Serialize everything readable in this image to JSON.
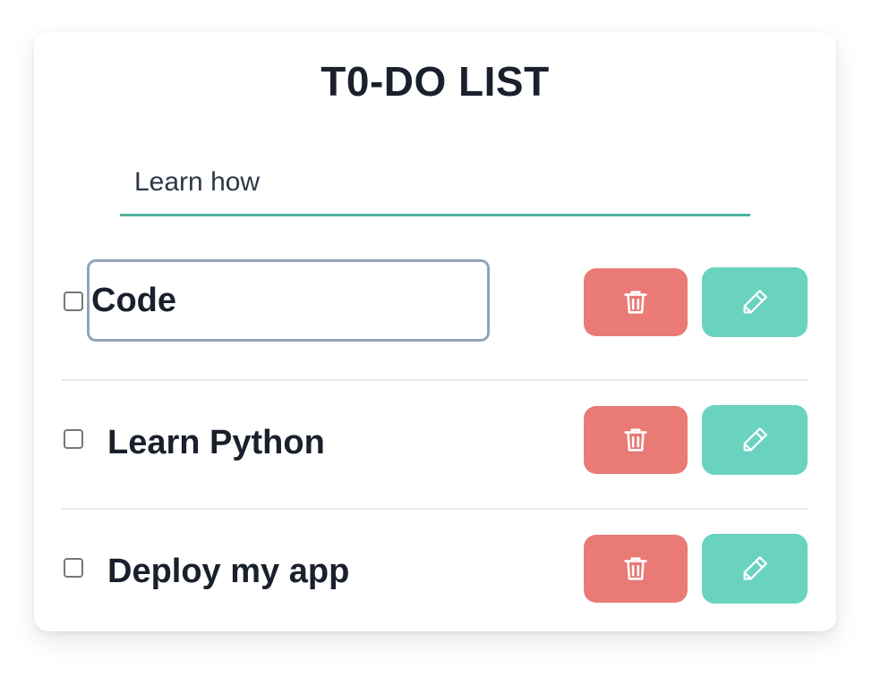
{
  "app": {
    "title": "T0-DO LIST"
  },
  "new_todo": {
    "value": "Learn how"
  },
  "todos": [
    {
      "label": "Code",
      "editing": true,
      "checked": false
    },
    {
      "label": "Learn Python",
      "editing": false,
      "checked": false
    },
    {
      "label": "Deploy my app",
      "editing": false,
      "checked": false
    }
  ],
  "icons": {
    "delete": "trash-icon",
    "edit": "pencil-icon"
  },
  "colors": {
    "delete": "#e97a75",
    "edit": "#69d3c0",
    "accent": "#4fb3a0"
  }
}
